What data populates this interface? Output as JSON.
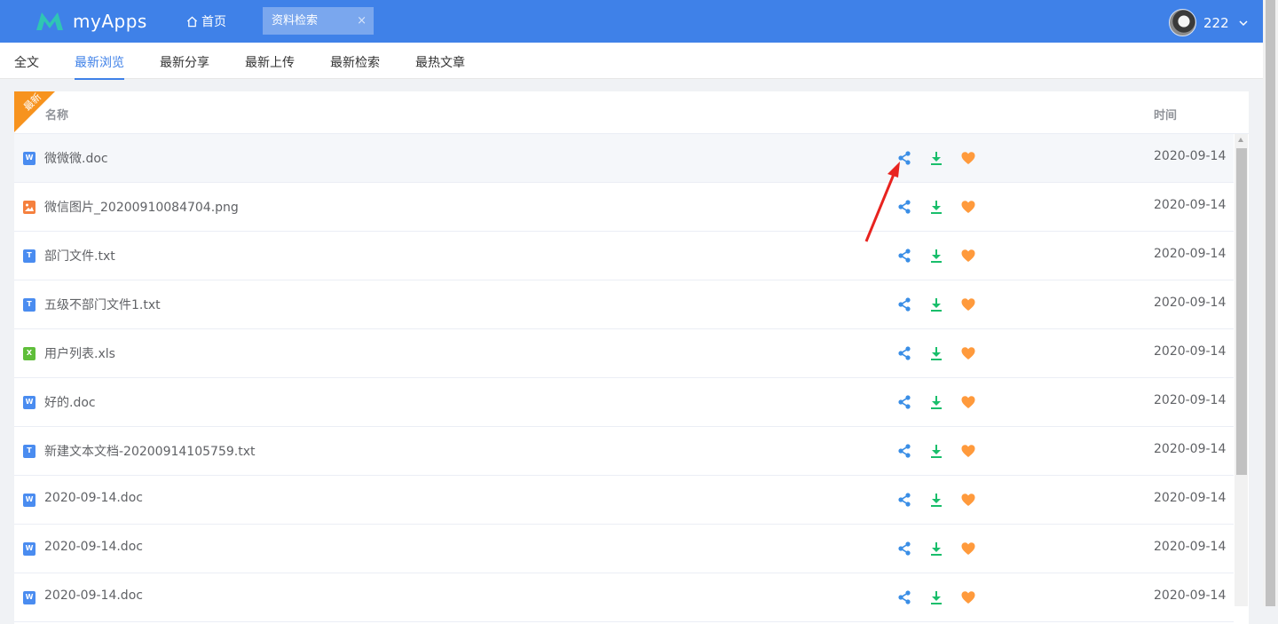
{
  "header": {
    "app_name": "myApps",
    "home_label": "首页",
    "open_tab": "资料检索",
    "tab_close": "×",
    "user_name": "222",
    "brand_color": "#3f81e8"
  },
  "subtabs": [
    {
      "label": "全文"
    },
    {
      "label": "最新浏览"
    },
    {
      "label": "最新分享"
    },
    {
      "label": "最新上传"
    },
    {
      "label": "最新检索"
    },
    {
      "label": "最热文章"
    }
  ],
  "active_subtab": "最新浏览",
  "table": {
    "ribbon": "最新",
    "col_name": "名称",
    "col_time": "时间",
    "rows": [
      {
        "type": "doc",
        "badge": "W",
        "name": "微微微.doc",
        "date": "2020-09-14"
      },
      {
        "type": "image",
        "badge": "",
        "name": "微信图片_20200910084704.png",
        "date": "2020-09-14"
      },
      {
        "type": "txt",
        "badge": "T",
        "name": "部门文件.txt",
        "date": "2020-09-14"
      },
      {
        "type": "txt",
        "badge": "T",
        "name": "五级不部门文件1.txt",
        "date": "2020-09-14"
      },
      {
        "type": "xls",
        "badge": "X",
        "name": "用户列表.xls",
        "date": "2020-09-14"
      },
      {
        "type": "doc",
        "badge": "W",
        "name": "好的.doc",
        "date": "2020-09-14"
      },
      {
        "type": "txt",
        "badge": "T",
        "name": "新建文本文档-20200914105759.txt",
        "date": "2020-09-14"
      },
      {
        "type": "doc",
        "badge": "W",
        "name": "2020-09-14.doc",
        "date": "2020-09-14"
      },
      {
        "type": "doc",
        "badge": "W",
        "name": "2020-09-14.doc",
        "date": "2020-09-14"
      },
      {
        "type": "doc",
        "badge": "W",
        "name": "2020-09-14.doc",
        "date": "2020-09-14"
      }
    ],
    "actions": [
      "share-icon",
      "download-icon",
      "favorite-heart-icon"
    ],
    "icon_colors": {
      "share": "#3a8ee6",
      "download": "#19be6b",
      "favorite": "#ff9a3c"
    }
  }
}
